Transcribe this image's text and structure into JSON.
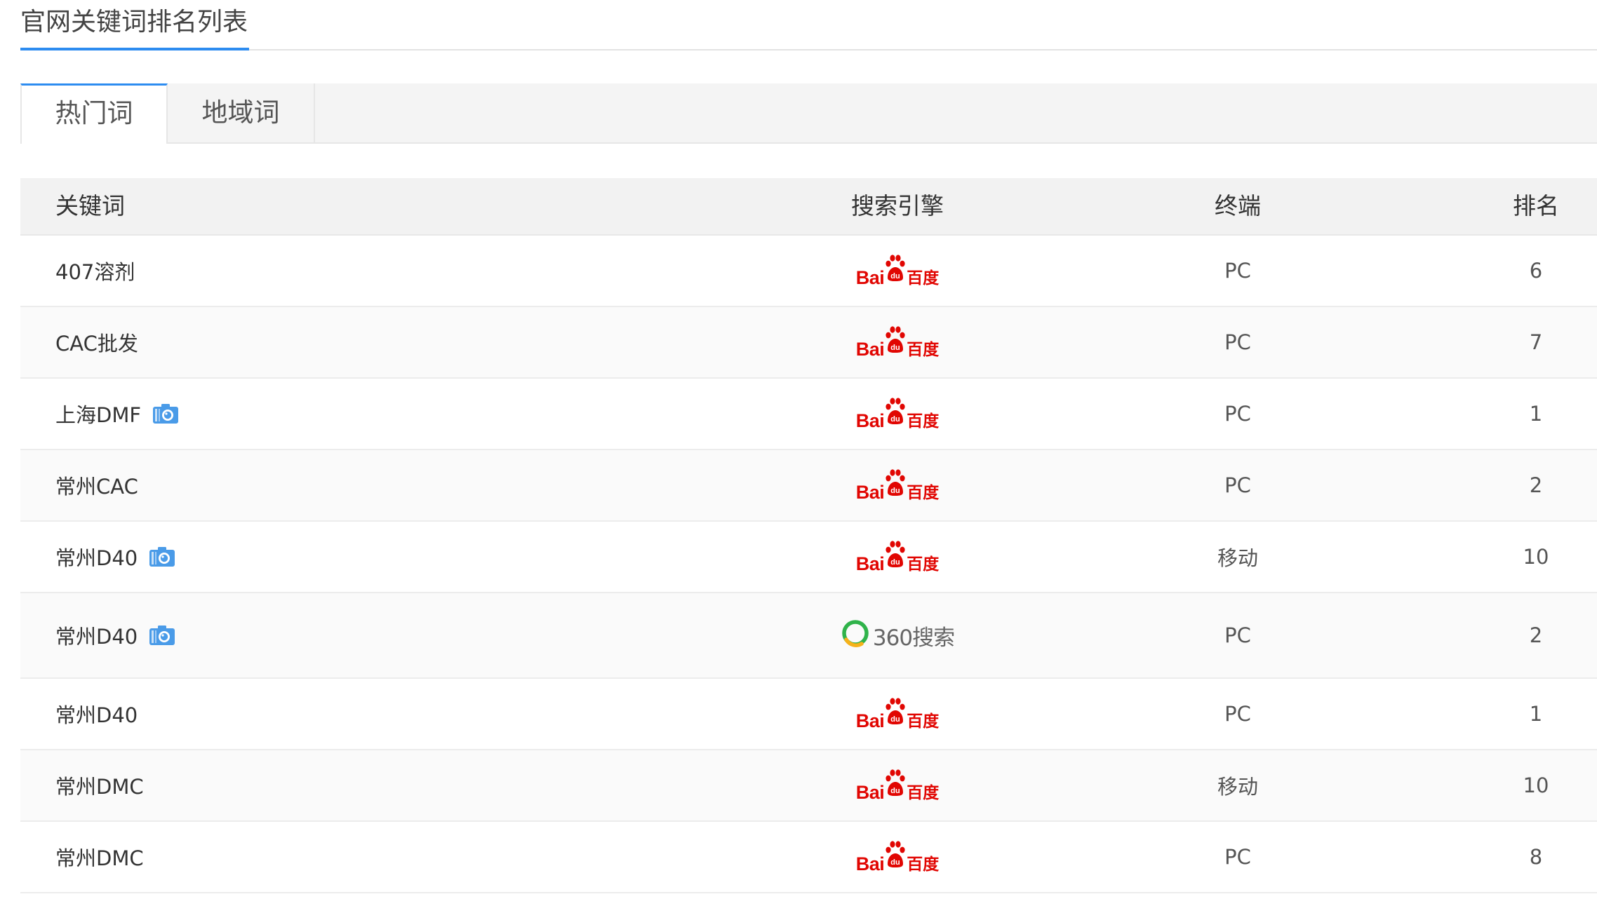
{
  "section": {
    "title": "官网关键词排名列表"
  },
  "tabs": [
    {
      "label": "热门词",
      "active": true
    },
    {
      "label": "地域词",
      "active": false
    }
  ],
  "table": {
    "headers": {
      "keyword": "关键词",
      "engine": "搜索引擎",
      "terminal": "终端",
      "rank": "排名"
    },
    "engine_logos": {
      "baidu": {
        "latin": "Bai",
        "paw_text": "du",
        "chinese": "百度",
        "color": "#e10602"
      },
      "so360": {
        "text": "360搜索",
        "ring_color": "#2fb34a",
        "accent_color": "#f6b21a"
      }
    },
    "rows": [
      {
        "keyword": "407溶剂",
        "snapshot": false,
        "engine": "baidu",
        "terminal": "PC",
        "rank": "6"
      },
      {
        "keyword": "CAC批发",
        "snapshot": false,
        "engine": "baidu",
        "terminal": "PC",
        "rank": "7"
      },
      {
        "keyword": "上海DMF",
        "snapshot": true,
        "engine": "baidu",
        "terminal": "PC",
        "rank": "1"
      },
      {
        "keyword": "常州CAC",
        "snapshot": false,
        "engine": "baidu",
        "terminal": "PC",
        "rank": "2"
      },
      {
        "keyword": "常州D40",
        "snapshot": true,
        "engine": "baidu",
        "terminal": "移动",
        "rank": "10"
      },
      {
        "keyword": "常州D40",
        "snapshot": true,
        "engine": "so360",
        "terminal": "PC",
        "rank": "2"
      },
      {
        "keyword": "常州D40",
        "snapshot": false,
        "engine": "baidu",
        "terminal": "PC",
        "rank": "1"
      },
      {
        "keyword": "常州DMC",
        "snapshot": false,
        "engine": "baidu",
        "terminal": "移动",
        "rank": "10"
      },
      {
        "keyword": "常州DMC",
        "snapshot": false,
        "engine": "baidu",
        "terminal": "PC",
        "rank": "8"
      }
    ]
  },
  "icons": {
    "snapshot": "camera-icon",
    "accent": "#2d8cf0",
    "snapshot_color": "#4a9be8"
  }
}
